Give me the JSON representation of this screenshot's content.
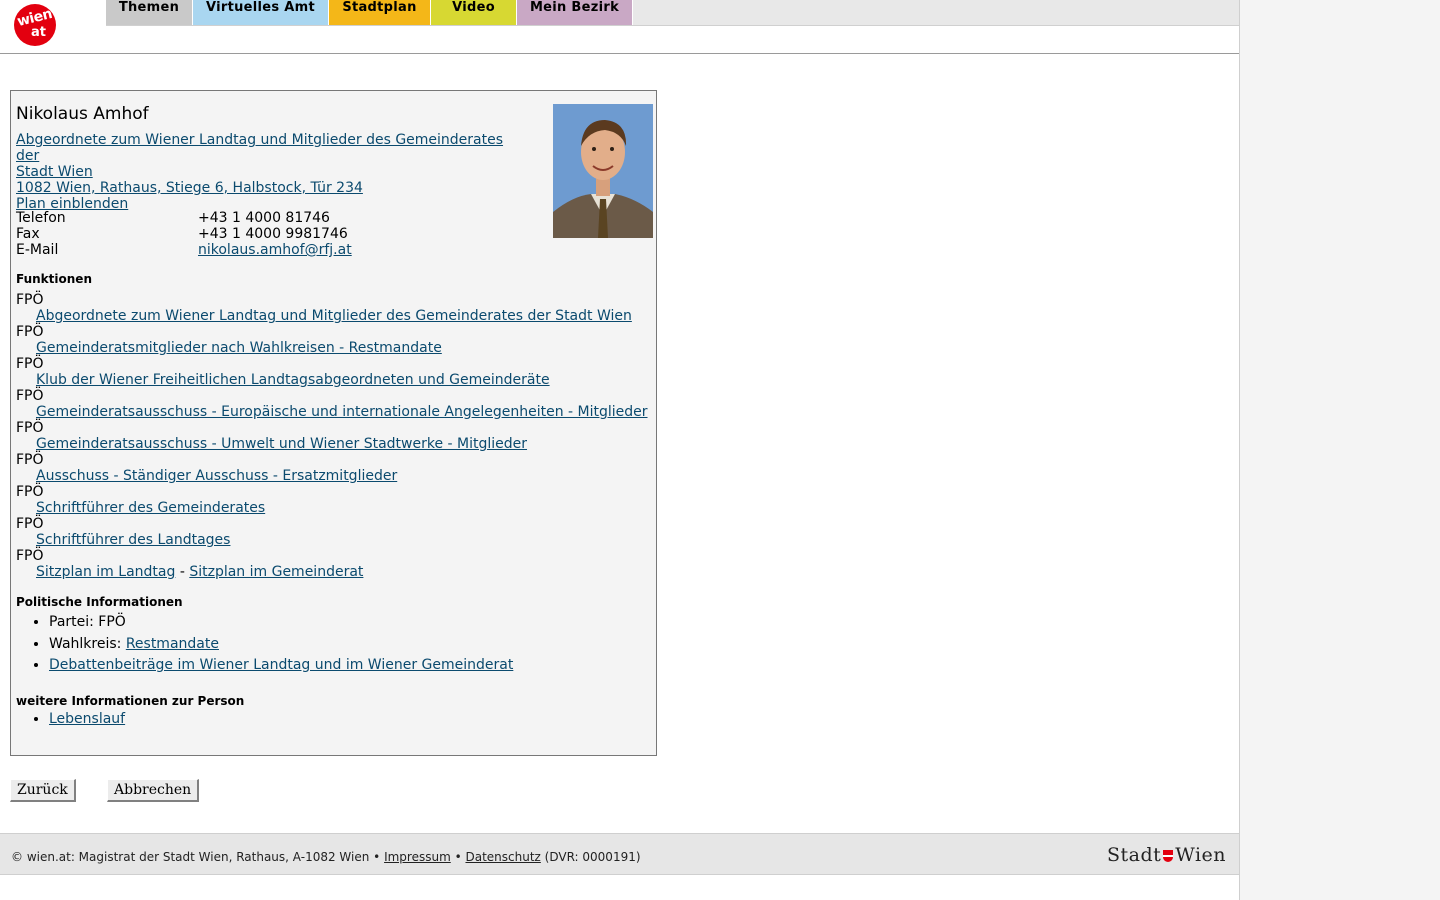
{
  "header": {
    "logo_top": "wien",
    "logo_bottom": "at",
    "tabs": [
      {
        "label": "Themen",
        "color": "#c9c9c9"
      },
      {
        "label": "Virtuelles Amt",
        "color": "#a9d6f0"
      },
      {
        "label": "Stadtplan",
        "color": "#f4b718"
      },
      {
        "label": "Video",
        "color": "#d7d832"
      },
      {
        "label": "Mein Bezirk",
        "color": "#c9a8c5"
      }
    ]
  },
  "person": {
    "name": "Nikolaus Amhof",
    "affiliation_line1": "Abgeordnete zum Wiener Landtag und Mitglieder des Gemeinderates der",
    "affiliation_line2": "Stadt Wien ",
    "address": "1082 Wien, Rathaus, Stiege 6, Halbstock, Tür 234",
    "plan_link": "Plan einblenden",
    "contact": {
      "phone_label": "Telefon",
      "phone": "+43 1 4000 81746",
      "fax_label": "Fax",
      "fax": "+43 1 4000 9981746",
      "email_label": "E-Mail",
      "email": "nikolaus.amhof@rfj.at"
    }
  },
  "funktionen": {
    "heading": "Funktionen",
    "items": [
      {
        "party": "FPÖ",
        "link": "Abgeordnete zum Wiener Landtag und Mitglieder des Gemeinderates der Stadt Wien"
      },
      {
        "party": "FPÖ",
        "link": "Gemeinderatsmitglieder nach Wahlkreisen - Restmandate"
      },
      {
        "party": "FPÖ",
        "link": "Klub der Wiener Freiheitlichen Landtagsabgeordneten und Gemeinderäte"
      },
      {
        "party": "FPÖ",
        "link": "Gemeinderatsausschuss - Europäische und internationale Angelegenheiten - Mitglieder"
      },
      {
        "party": "FPÖ",
        "link": "Gemeinderatsausschuss - Umwelt und Wiener Stadtwerke - Mitglieder"
      },
      {
        "party": "FPÖ",
        "link": "Ausschuss - Ständiger Ausschuss - Ersatzmitglieder"
      },
      {
        "party": "FPÖ",
        "link": "Schriftführer des Gemeinderates"
      },
      {
        "party": "FPÖ",
        "link": "Schriftführer des Landtages"
      }
    ],
    "last_party": "FPÖ",
    "sitzplan_landtag": "Sitzplan im Landtag",
    "separator": " - ",
    "sitzplan_gemeinderat": "Sitzplan im Gemeinderat"
  },
  "politisch": {
    "heading": "Politische Informationen",
    "partei_label": "Partei: FPÖ",
    "wahlkreis_label": "Wahlkreis: ",
    "wahlkreis_link": "Restmandate",
    "debatten_link": "Debattenbeiträge im Wiener Landtag und im Wiener Gemeinderat"
  },
  "weitere": {
    "heading": "weitere Informationen zur Person",
    "lebenslauf_link": "Lebenslauf"
  },
  "buttons": {
    "back": "Zurück",
    "cancel": "Abbrechen"
  },
  "footer": {
    "text": "© wien.at: Magistrat der Stadt Wien, Rathaus, A-1082 Wien • ",
    "impressum": "Impressum",
    "bullet": " • ",
    "datenschutz": "Datenschutz",
    "dvr": " (DVR: 0000191)",
    "logo_part1": "Stadt",
    "logo_part2": "Wien"
  }
}
